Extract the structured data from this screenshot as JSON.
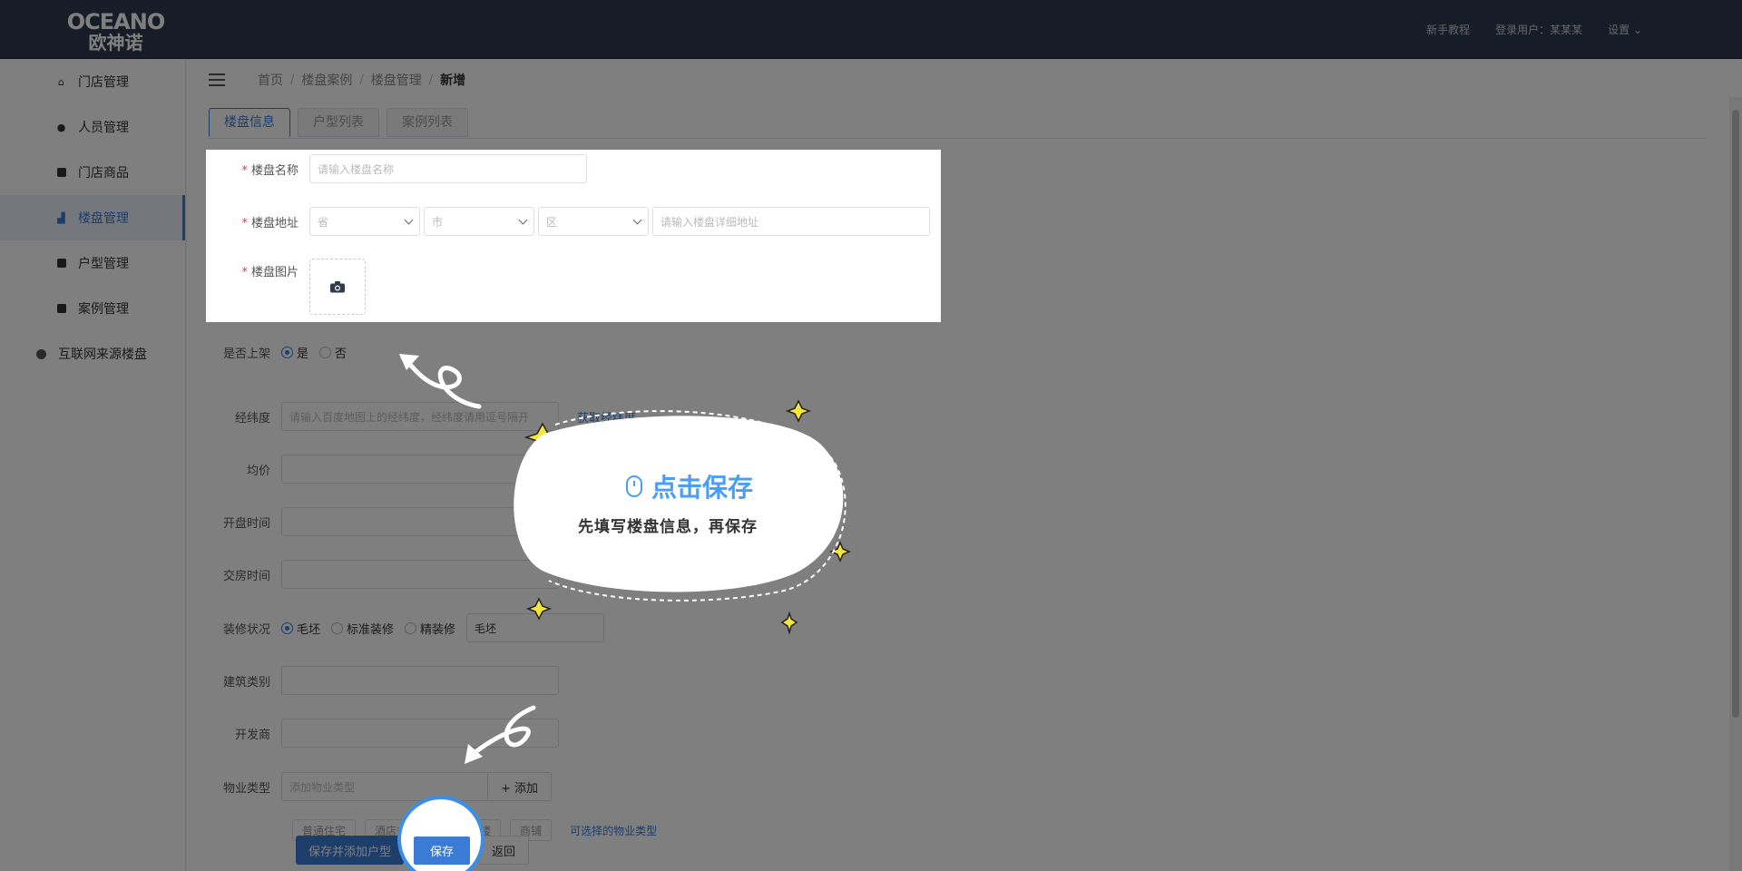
{
  "header": {
    "logo_en": "OCEANO",
    "logo_cn": "欧神诺",
    "tutorial": "新手教程",
    "user": "登录用户：某某某",
    "settings": "设置"
  },
  "sidebar": {
    "items": [
      {
        "label": "门店管理",
        "icon": "home-icon"
      },
      {
        "label": "人员管理",
        "icon": "user-icon"
      },
      {
        "label": "门店商品",
        "icon": "product-icon"
      },
      {
        "label": "楼盘管理",
        "icon": "building-icon",
        "active": true
      },
      {
        "label": "户型管理",
        "icon": "floorplan-icon"
      },
      {
        "label": "案例管理",
        "icon": "case-icon"
      },
      {
        "label": "互联网来源楼盘",
        "icon": "globe-icon"
      }
    ]
  },
  "breadcrumb": [
    "首页",
    "楼盘案例",
    "楼盘管理",
    "新增"
  ],
  "tabs": [
    "楼盘信息",
    "户型列表",
    "案例列表"
  ],
  "form": {
    "name_label": "楼盘名称",
    "name_placeholder": "请输入楼盘名称",
    "address_label": "楼盘地址",
    "province": "省",
    "city": "市",
    "district": "区",
    "address_placeholder": "请输入楼盘详细地址",
    "image_label": "楼盘图片",
    "listed_label": "是否上架",
    "listed_yes": "是",
    "listed_no": "否",
    "coord_label": "经纬度",
    "coord_placeholder": "请输入百度地图上的经纬度，经纬度请用逗号隔开",
    "coord_link": "获取经纬度",
    "price_label": "均价",
    "open_label": "开盘时间",
    "deliver_label": "交房时间",
    "decor_label": "装修状况",
    "decor_options": [
      "毛坯",
      "标准装修",
      "精装修"
    ],
    "decor_value": "毛坯",
    "building_type_label": "建筑类别",
    "developer_label": "开发商",
    "property_label": "物业类型",
    "property_placeholder": "添加物业类型",
    "add_button": "+ 添加",
    "property_tags": [
      "普通住宅",
      "酒店式公寓",
      "写字楼",
      "商铺"
    ],
    "property_hint": "可选择的物业类型"
  },
  "footer": {
    "save_add": "保存并添加户型",
    "save": "保存",
    "back": "返回"
  },
  "guide": {
    "title": "点击保存",
    "subtitle": "先填写楼盘信息，再保存"
  },
  "colors": {
    "primary": "#3a7bd5",
    "topbar": "#2f3a4c",
    "guide_title": "#4a9ff5"
  }
}
